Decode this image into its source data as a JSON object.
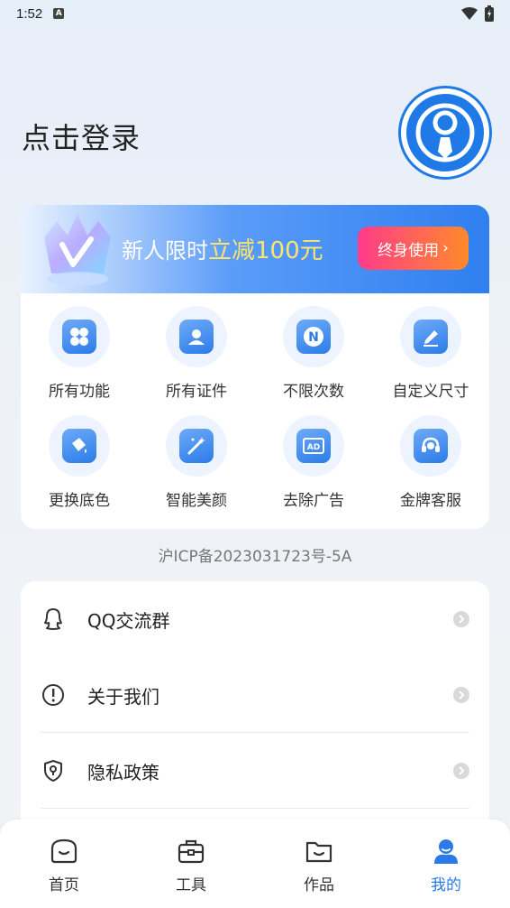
{
  "status_bar": {
    "time": "1:52",
    "notif_letter": "A"
  },
  "header": {
    "login_title": "点击登录"
  },
  "promo": {
    "text_prefix": "新人限时",
    "text_highlight": "立减100元",
    "button_label": "终身使用",
    "button_arrow": "›"
  },
  "features": [
    {
      "label": "所有功能",
      "icon": "grid-icon"
    },
    {
      "label": "所有证件",
      "icon": "id-card-icon"
    },
    {
      "label": "不限次数",
      "icon": "unlimited-icon"
    },
    {
      "label": "自定义尺寸",
      "icon": "edit-icon"
    },
    {
      "label": "更换底色",
      "icon": "paint-bucket-icon"
    },
    {
      "label": "智能美颜",
      "icon": "magic-wand-icon"
    },
    {
      "label": "去除广告",
      "icon": "ad-icon"
    },
    {
      "label": "金牌客服",
      "icon": "headset-icon"
    }
  ],
  "icp": "沪ICP备2023031723号-5A",
  "menu": [
    {
      "label": "QQ交流群",
      "icon": "qq-icon"
    },
    {
      "label": "关于我们",
      "icon": "info-icon"
    },
    {
      "label": "隐私政策",
      "icon": "shield-icon"
    }
  ],
  "tabs": [
    {
      "label": "首页",
      "icon": "home-icon",
      "active": false
    },
    {
      "label": "工具",
      "icon": "toolbox-icon",
      "active": false
    },
    {
      "label": "作品",
      "icon": "folder-icon",
      "active": false
    },
    {
      "label": "我的",
      "icon": "profile-icon",
      "active": true
    }
  ],
  "colors": {
    "accent": "#2a7be8",
    "promo_btn_start": "#ff3b8a",
    "promo_btn_end": "#ff8a2a",
    "highlight": "#ffe56b"
  }
}
